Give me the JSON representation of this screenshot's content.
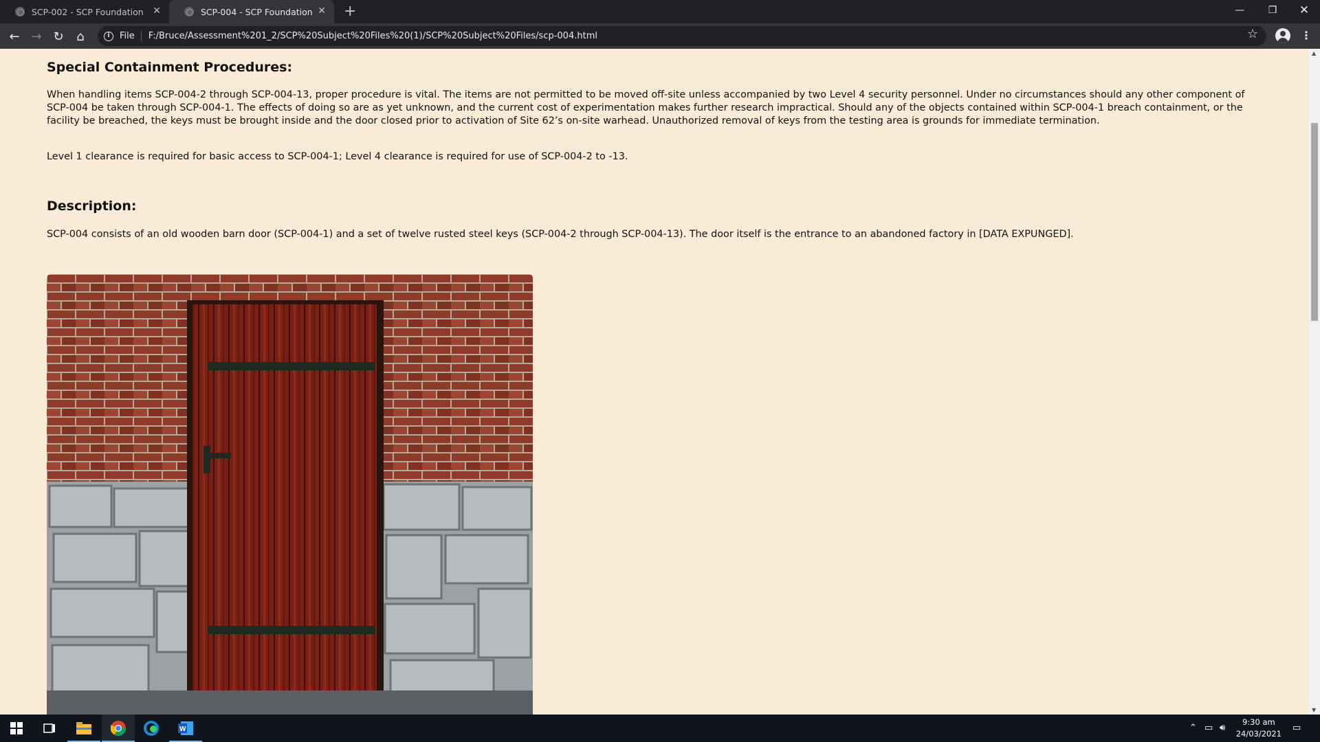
{
  "browser": {
    "tabs": [
      {
        "title": "SCP-002 - SCP Foundation",
        "active": false
      },
      {
        "title": "SCP-004 - SCP Foundation",
        "active": true
      }
    ],
    "address": {
      "scheme": "File",
      "url": "F:/Bruce/Assessment%201_2/SCP%20Subject%20Files%20(1)/SCP%20Subject%20Files/scp-004.html"
    }
  },
  "page": {
    "procedures_heading": "Special Containment Procedures:",
    "procedures_p1": "When handling items SCP-004-2 through SCP-004-13, proper procedure is vital. The items are not permitted to be moved off-site unless accompanied by two Level 4 security personnel. Under no circumstances should any other component of SCP-004 be taken through SCP-004-1. The effects of doing so are as yet unknown, and the current cost of experimentation makes further research impractical. Should any of the objects contained within SCP-004-1 breach containment, or the facility be breached, the keys must be brought inside and the door closed prior to activation of Site 62’s on-site warhead. Unauthorized removal of keys from the testing area is grounds for immediate termination.",
    "procedures_p2": "Level 1 clearance is required for basic access to SCP-004-1; Level 4 clearance is required for use of SCP-004-2 to -13.",
    "description_heading": "Description:",
    "description_p1": "SCP-004 consists of an old wooden barn door (SCP-004-1) and a set of twelve rusted steel keys (SCP-004-2 through SCP-004-13). The door itself is the entrance to an abandoned factory in [DATA EXPUNGED]."
  },
  "taskbar": {
    "time": "9:30 am",
    "date": "24/03/2021"
  }
}
